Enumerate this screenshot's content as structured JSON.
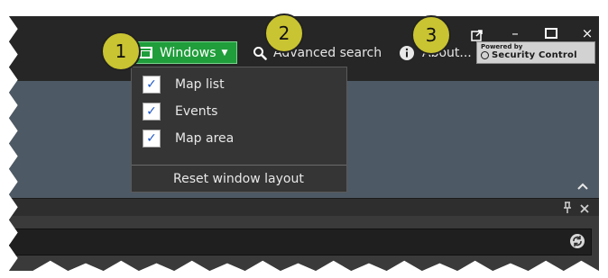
{
  "window_controls": {
    "pop_out_icon": "⧉",
    "minimize_icon": "–",
    "maximize_icon": "□",
    "close_icon": "×"
  },
  "toolbar": {
    "windows_label": "Windows",
    "advanced_search_label": "Advanced search",
    "about_label": "About...",
    "powered_by_small": "Powered by",
    "powered_by_brand": "Security Control"
  },
  "windows_menu": {
    "items": [
      {
        "label": "Map list",
        "checked": true
      },
      {
        "label": "Events",
        "checked": true
      },
      {
        "label": "Map area",
        "checked": true
      }
    ],
    "reset_label": "Reset window layout"
  },
  "panel": {
    "collapse_icon": "chevron-up-icon"
  },
  "dock_strip": {
    "pin_icon": "pin-icon",
    "close_icon": "close-icon"
  },
  "search_panel": {
    "refresh_icon": "refresh-icon"
  },
  "callouts": [
    "1",
    "2",
    "3"
  ],
  "colors": {
    "accent_green": "#1f9e3b",
    "callout_yellow": "#c9c431",
    "panel_blue_gray": "#4d5964"
  }
}
